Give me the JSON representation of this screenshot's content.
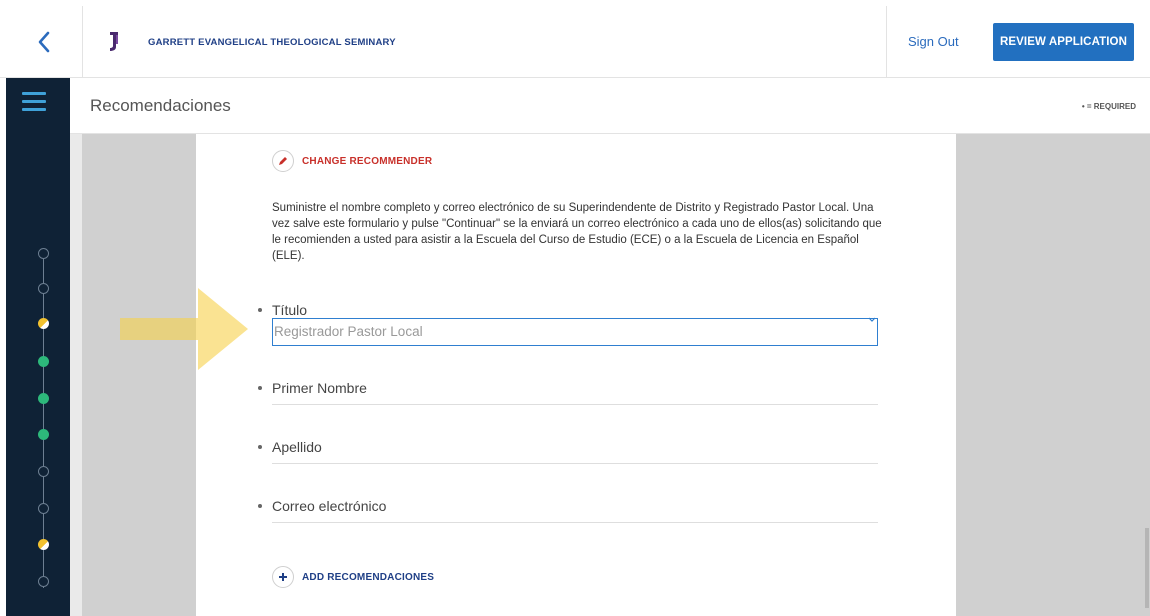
{
  "header": {
    "school_name": "GARRETT EVANGELICAL THEOLOGICAL SEMINARY",
    "sign_out": "Sign Out",
    "review_button": "REVIEW APPLICATION"
  },
  "subheader": {
    "title": "Recomendaciones",
    "required_note": "• = REQUIRED"
  },
  "form": {
    "change_recommender": "CHANGE RECOMMENDER",
    "intro_text": "Suministre el nombre completo y correo electrónico de su Superindendente de Distrito y Registrado Pastor Local. Una vez salve este formulario y pulse \"Continuar\" se la enviará un correo electrónico a cada uno de ellos(as) solicitando que le recomienden a usted para asistir a la Escuela del Curso de Estudio (ECE) o a la Escuela de Licencia en Español (ELE).",
    "fields": {
      "titulo_label": "Título",
      "titulo_value": "Registrador Pastor Local",
      "primer_nombre_label": "Primer Nombre",
      "apellido_label": "Apellido",
      "correo_label": "Correo electrónico"
    },
    "add_recommendation": "ADD RECOMENDACIONES"
  },
  "progress_steps": [
    "empty",
    "empty",
    "partial",
    "done",
    "done",
    "done",
    "empty",
    "empty",
    "partial",
    "empty"
  ],
  "colors": {
    "sidebar_bg": "#0f2236",
    "accent_blue": "#2270c0",
    "link_blue": "#2b6bbd",
    "change_red": "#c8302a",
    "step_done": "#2db87b",
    "step_partial": "#f2c230"
  }
}
